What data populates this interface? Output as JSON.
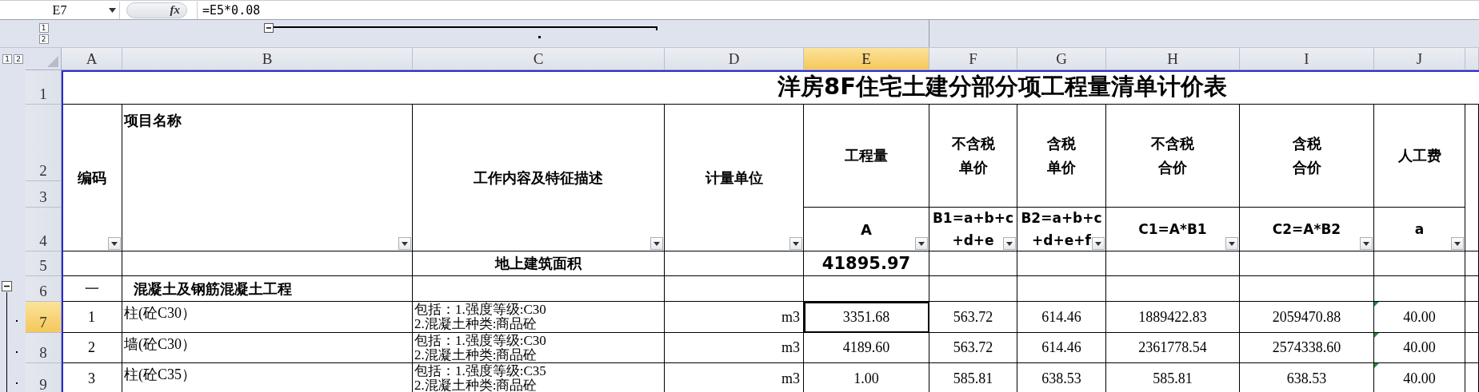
{
  "formula_bar": {
    "name_box": "E7",
    "function_label": "fx",
    "formula": "=E5*0.08"
  },
  "column_outline": {
    "levels": [
      "1",
      "2"
    ]
  },
  "row_outline": {
    "levels": [
      "1",
      "2"
    ]
  },
  "columns": [
    {
      "label": "A",
      "selected": false
    },
    {
      "label": "B",
      "selected": false
    },
    {
      "label": "C",
      "selected": false
    },
    {
      "label": "D",
      "selected": false
    },
    {
      "label": "E",
      "selected": true
    },
    {
      "label": "F",
      "selected": false
    },
    {
      "label": "G",
      "selected": false
    },
    {
      "label": "H",
      "selected": false
    },
    {
      "label": "I",
      "selected": false
    },
    {
      "label": "J",
      "selected": false
    }
  ],
  "rows": [
    {
      "label": "1",
      "selected": false
    },
    {
      "label": "2",
      "selected": false
    },
    {
      "label": "3",
      "selected": false
    },
    {
      "label": "4",
      "selected": false
    },
    {
      "label": "5",
      "selected": false
    },
    {
      "label": "6",
      "selected": false
    },
    {
      "label": "7",
      "selected": true
    },
    {
      "label": "8",
      "selected": false
    },
    {
      "label": "9",
      "selected": false
    }
  ],
  "title": "洋房8F住宅土建分部分项工程量清单计价表",
  "header": {
    "code": "编码",
    "name": "项目名称",
    "description": "工作内容及特征描述",
    "unit": "计量单位",
    "quantity": "工程量",
    "quantity_symbol": "A",
    "price_columns": [
      {
        "label": [
          "不含税",
          "单价"
        ],
        "formula": [
          "B1=a+b+c",
          "+d+e"
        ]
      },
      {
        "label": [
          "含税",
          "单价"
        ],
        "formula": [
          "B2=a+b+c",
          "+d+e+f"
        ]
      },
      {
        "label": [
          "不含税",
          "合价"
        ],
        "formula": [
          "C1=A*B1"
        ]
      },
      {
        "label": [
          "含税",
          "合价"
        ],
        "formula": [
          "C2=A*B2"
        ]
      },
      {
        "label": [
          "人工费"
        ],
        "formula": [
          "a"
        ]
      }
    ]
  },
  "summary_row": {
    "description": "地上建筑面积",
    "quantity": "41895.97"
  },
  "section_row": {
    "code": "一",
    "name": "混凝土及钢筋混凝土工程"
  },
  "items": [
    {
      "code": "1",
      "name": "柱(砼C30）",
      "description": [
        "包括：1.强度等级:C30",
        "2.混凝土种类:商品砼"
      ],
      "unit": "m3",
      "quantity": "3351.68",
      "values": [
        "563.72",
        "614.46",
        "1889422.83",
        "2059470.88",
        "40.00"
      ]
    },
    {
      "code": "2",
      "name": "墙(砼C30）",
      "description": [
        "包括：1.强度等级:C30",
        "2.混凝土种类:商品砼"
      ],
      "unit": "m3",
      "quantity": "4189.60",
      "values": [
        "563.72",
        "614.46",
        "2361778.54",
        "2574338.60",
        "40.00"
      ]
    },
    {
      "code": "3",
      "name": "柱(砼C35）",
      "description": [
        "包括：1.强度等级:C35",
        "2.混凝土种类:商品砼"
      ],
      "unit": "m3",
      "quantity": "1.00",
      "values": [
        "585.81",
        "638.53",
        "585.81",
        "638.53",
        "40.00"
      ]
    }
  ]
}
